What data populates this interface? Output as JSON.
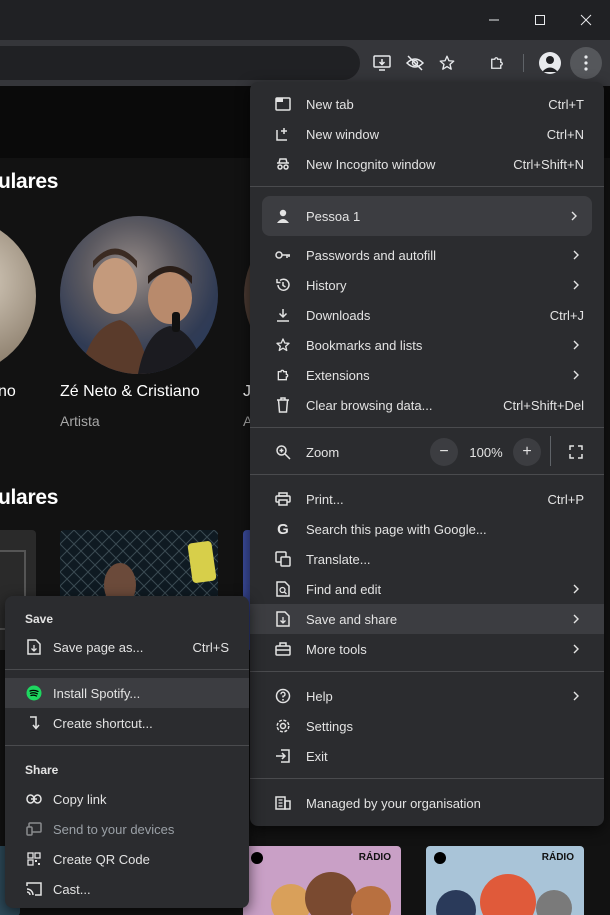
{
  "page": {
    "section_artists": "ulares",
    "section_second": "ulares",
    "artist_left_fragment": "no",
    "artist_main_name": "Zé Neto & Cristiano",
    "artist_main_type": "Artista",
    "artist_right_fragment": "J",
    "artist_right_sub_fragment": "A",
    "card_right_1_badge": "RÁDIO",
    "card_right_2_badge": "RÁDIO"
  },
  "main_menu": {
    "items": [
      {
        "label": "New tab",
        "shortcut": "Ctrl+T",
        "icon": "new-tab-icon"
      },
      {
        "label": "New window",
        "shortcut": "Ctrl+N",
        "icon": "new-window-icon"
      },
      {
        "label": "New Incognito window",
        "shortcut": "Ctrl+Shift+N",
        "icon": "incognito-icon"
      },
      {
        "label": "Pessoa 1",
        "icon": "person-icon"
      },
      {
        "label": "Passwords and autofill",
        "icon": "key-icon"
      },
      {
        "label": "History",
        "icon": "history-icon"
      },
      {
        "label": "Downloads",
        "shortcut": "Ctrl+J",
        "icon": "download-icon"
      },
      {
        "label": "Bookmarks and lists",
        "icon": "star-icon"
      },
      {
        "label": "Extensions",
        "icon": "puzzle-icon"
      },
      {
        "label": "Clear browsing data...",
        "shortcut": "Ctrl+Shift+Del",
        "icon": "trash-icon"
      },
      {
        "label": "Zoom",
        "icon": "zoom-icon"
      },
      {
        "label": "Print...",
        "shortcut": "Ctrl+P",
        "icon": "print-icon"
      },
      {
        "label": "Search this page with Google...",
        "icon": "google-icon"
      },
      {
        "label": "Translate...",
        "icon": "translate-icon"
      },
      {
        "label": "Find and edit",
        "icon": "find-icon"
      },
      {
        "label": "Save and share",
        "icon": "save-share-icon"
      },
      {
        "label": "More tools",
        "icon": "toolbox-icon"
      },
      {
        "label": "Help",
        "icon": "help-icon"
      },
      {
        "label": "Settings",
        "icon": "settings-icon"
      },
      {
        "label": "Exit",
        "icon": "exit-icon"
      },
      {
        "label": "Managed by your organisation",
        "icon": "building-icon"
      }
    ],
    "zoom_level": "100%",
    "zoom_minus": "−",
    "zoom_plus": "+"
  },
  "sub_menu": {
    "save_heading": "Save",
    "share_heading": "Share",
    "items": [
      {
        "label": "Save page as...",
        "shortcut": "Ctrl+S",
        "icon": "save-page-icon"
      },
      {
        "label": "Install Spotify...",
        "icon": "spotify-icon"
      },
      {
        "label": "Create shortcut...",
        "icon": "shortcut-icon"
      },
      {
        "label": "Copy link",
        "icon": "link-icon"
      },
      {
        "label": "Send to your devices",
        "icon": "devices-icon"
      },
      {
        "label": "Create QR Code",
        "icon": "qr-code-icon"
      },
      {
        "label": "Cast...",
        "icon": "cast-icon"
      }
    ]
  },
  "colors": {
    "menu_bg": "#2b2c2f",
    "highlight": "#3c3d41",
    "spotify_green": "#1ed760",
    "chrome_toolbar": "#35363a"
  }
}
